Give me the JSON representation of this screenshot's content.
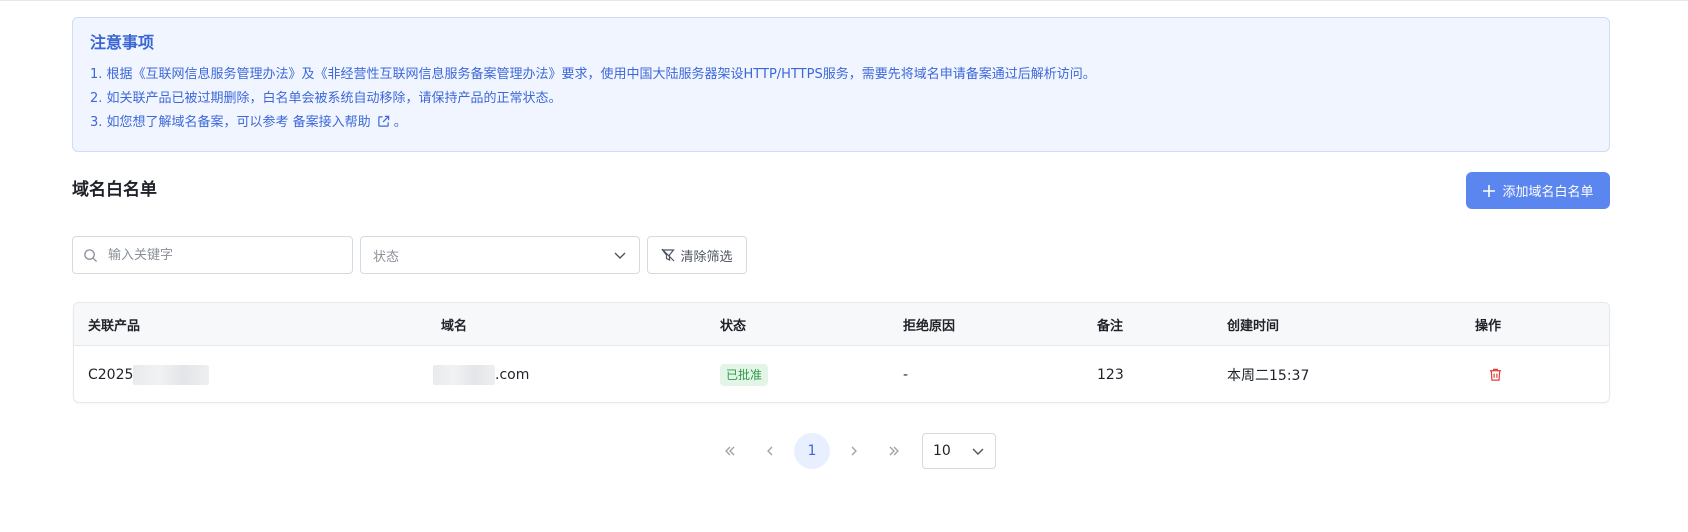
{
  "notice": {
    "title": "注意事项",
    "line1": "1. 根据《互联网信息服务管理办法》及《非经营性互联网信息服务备案管理办法》要求，使用中国大陆服务器架设HTTP/HTTPS服务，需要先将域名申请备案通过后解析访问。",
    "line2": "2. 如关联产品已被过期删除，白名单会被系统自动移除，请保持产品的正常状态。",
    "line3_prefix": "3. 如您想了解域名备案，可以参考 ",
    "line3_link": "备案接入帮助",
    "line3_suffix": "。"
  },
  "section": {
    "title": "域名白名单",
    "add_button": "添加域名白名单"
  },
  "filters": {
    "search_placeholder": "输入关键字",
    "status_placeholder": "状态",
    "clear_button": "清除筛选"
  },
  "table": {
    "headers": [
      "关联产品",
      "域名",
      "状态",
      "拒绝原因",
      "备注",
      "创建时间",
      "操作"
    ],
    "rows": [
      {
        "product": "C2025",
        "domain": ".com",
        "status": "已批准",
        "reject_reason": "-",
        "remark": "123",
        "created": "本周二15:37"
      }
    ]
  },
  "pagination": {
    "current_page": "1",
    "page_size": "10"
  },
  "colors": {
    "accent": "#5b86ef",
    "notice_bg": "#f0f5ff",
    "notice_text": "#3d68d8",
    "success_bg": "#e3f5e6",
    "success_text": "#2f9a48",
    "danger": "#e0403f"
  }
}
